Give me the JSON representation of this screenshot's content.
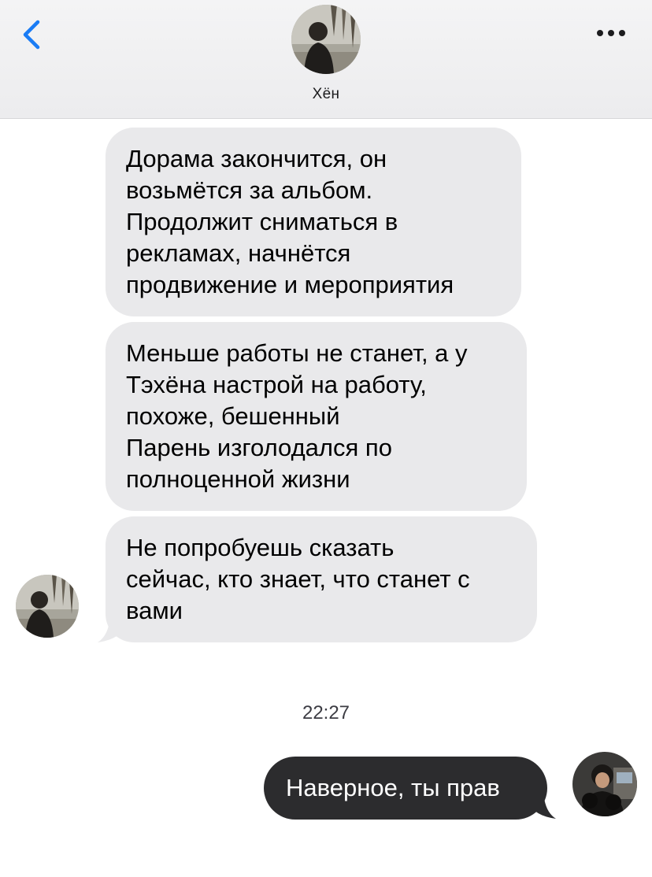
{
  "header": {
    "back_icon": "chevron-left-icon",
    "more_icon": "ellipsis-icon",
    "contact_name": "Хён",
    "accent_color": "#1a7cf5"
  },
  "messages": [
    {
      "direction": "incoming",
      "text": "Дорама закончится, он\nвозьмётся за альбом.\nПродолжит сниматься в\nрекламах, начнётся\nпродвижение и мероприятия"
    },
    {
      "direction": "incoming",
      "text": "Меньше работы не станет, а у\nТэхёна настрой на работу,\nпохоже, бешенный\nПарень изголодался по\nполноценной жизни"
    },
    {
      "direction": "incoming",
      "text": "Не попробуешь сказать\nсейчас, кто знает, что станет с\nвами"
    }
  ],
  "timestamp": "22:27",
  "outgoing": {
    "text": "Наверное, ты прав"
  },
  "colors": {
    "incoming_bubble": "#e9e9eb",
    "outgoing_bubble": "#2c2c2e",
    "header_bg": "#f2f2f3"
  }
}
